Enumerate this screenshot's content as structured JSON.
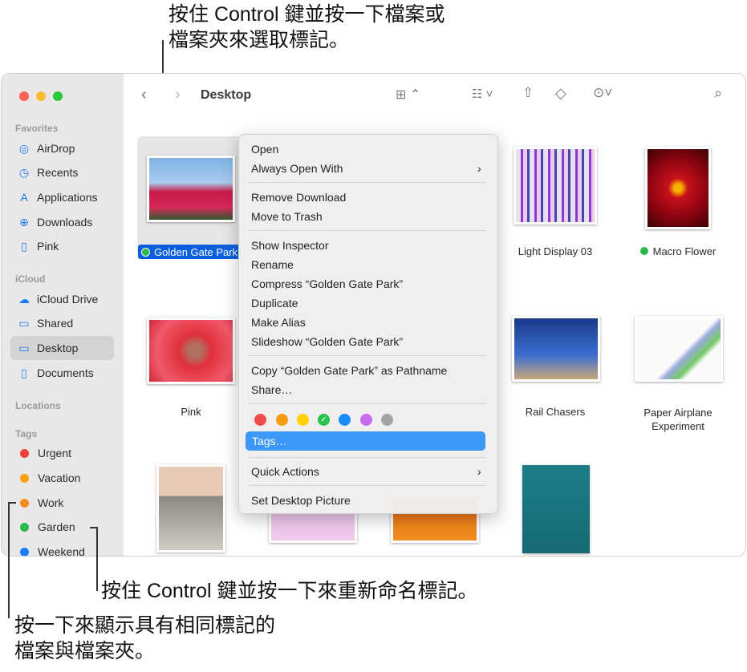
{
  "callouts": {
    "top": [
      "按住 Control 鍵並按一下檔案或",
      "檔案夾來選取標記。"
    ],
    "rename": "按住 Control 鍵並按一下來重新命名標記。",
    "show": [
      "按一下來顯示具有相同標記的",
      "檔案與檔案夾。"
    ]
  },
  "window": {
    "title": "Desktop"
  },
  "sidebar": {
    "favorites_header": "Favorites",
    "favorites": [
      {
        "label": "AirDrop",
        "icon": "airdrop-icon"
      },
      {
        "label": "Recents",
        "icon": "clock-icon"
      },
      {
        "label": "Applications",
        "icon": "applications-icon"
      },
      {
        "label": "Downloads",
        "icon": "download-icon"
      },
      {
        "label": "Pink",
        "icon": "document-icon"
      }
    ],
    "icloud_header": "iCloud",
    "icloud": [
      {
        "label": "iCloud Drive",
        "icon": "cloud-icon"
      },
      {
        "label": "Shared",
        "icon": "shared-folder-icon"
      },
      {
        "label": "Desktop",
        "icon": "desktop-icon",
        "selected": true
      },
      {
        "label": "Documents",
        "icon": "document-icon"
      }
    ],
    "locations_header": "Locations",
    "tags_header": "Tags",
    "tags": [
      {
        "label": "Urgent",
        "color": "#f2413c"
      },
      {
        "label": "Vacation",
        "color": "#f7a20e"
      },
      {
        "label": "Work",
        "color": "#f58c1f"
      },
      {
        "label": "Garden",
        "color": "#2bb84a"
      },
      {
        "label": "Weekend",
        "color": "#1a7cf5"
      }
    ]
  },
  "files": [
    {
      "name": "Golden Gate Park",
      "tag": "#2bb84a",
      "selected": true
    },
    {
      "name": "Light Display 03"
    },
    {
      "name": "Macro Flower",
      "tag": "#2bb84a"
    },
    {
      "name": "Pink"
    },
    {
      "name": "Rail Chasers"
    },
    {
      "name": "Paper Airplane Experiment"
    }
  ],
  "context_menu": {
    "items": [
      "Open",
      "Always Open With",
      "Remove Download",
      "Move to Trash",
      "Show Inspector",
      "Rename",
      "Compress “Golden Gate Park”",
      "Duplicate",
      "Make Alias",
      "Slideshow “Golden Gate Park”",
      "Copy “Golden Gate Park” as Pathname",
      "Share…",
      "Tags…",
      "Quick Actions",
      "Set Desktop Picture"
    ],
    "tag_colors": [
      "#f24b4b",
      "#f79c12",
      "#fdd10a",
      "#2bc251",
      "#1a8cf7",
      "#c96cf0",
      "#a3a3a5"
    ],
    "checked_color_index": 3,
    "highlighted": "Tags…"
  }
}
